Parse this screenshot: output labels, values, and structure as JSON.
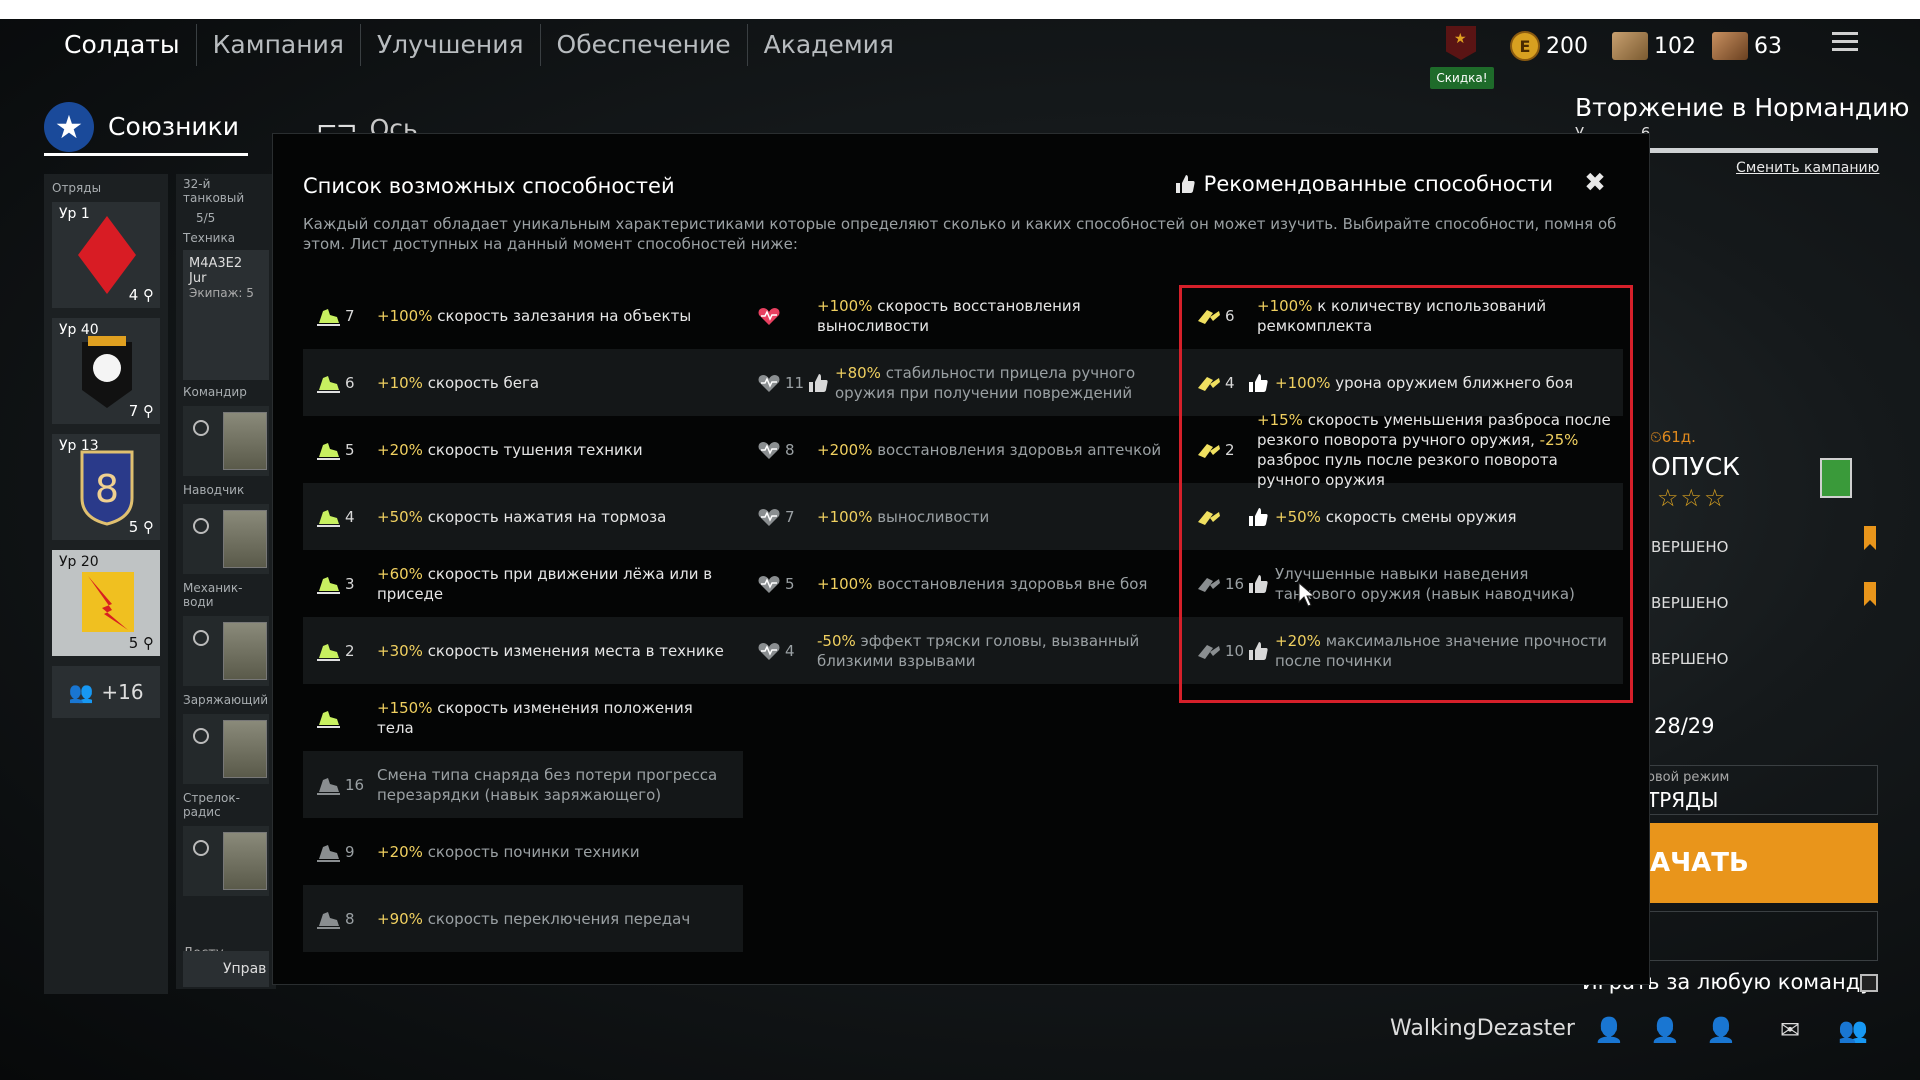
{
  "nav": {
    "tabs": [
      {
        "label": "Солдаты",
        "active": true
      },
      {
        "label": "Кампания",
        "active": false
      },
      {
        "label": "Улучшения",
        "active": false
      },
      {
        "label": "Обеспечение",
        "active": false
      },
      {
        "label": "Академия",
        "active": false
      }
    ]
  },
  "currency": {
    "gold": "200",
    "cards_a": "102",
    "cards_b": "63",
    "discount": "Скидка!"
  },
  "factions": {
    "allies": "Союзники",
    "axis": "Ось"
  },
  "squads": {
    "header": "Отряды",
    "items": [
      {
        "level": "Ур 1",
        "count": "4"
      },
      {
        "level": "Ур 40",
        "count": "7"
      },
      {
        "level": "Ур 13",
        "count": "5"
      },
      {
        "level": "Ур 20",
        "count": "5"
      }
    ],
    "reserve": "+16"
  },
  "crew": {
    "unit": "32-й танковый",
    "slots": "5/5",
    "vehicle_label": "Техника",
    "vehicle": "M4A3E2 Jur",
    "crew_count": "Экипаж: 5",
    "roles": [
      "Командир",
      "Наводчик",
      "Механик-води",
      "Заряжающий",
      "Стрелок-радис"
    ],
    "available": "Досту",
    "manage": "Управ"
  },
  "campaign": {
    "title": "Вторжение в Нормандию",
    "level_partial": "У",
    "level_num": "6",
    "change": "Сменить кампанию",
    "timer": "61д.",
    "mission": "ОПУСК",
    "done_1": "ВЕРШЕНО",
    "done_2": "ВЕРШЕНО",
    "done_3": "ВЕРШЕНО",
    "progress": "28/29",
    "mode_label": "овой режим",
    "mode_value": "ТРЯДЫ",
    "start": "АЧАТЬ",
    "any_team": "Играть за любую команду"
  },
  "user": {
    "name": "WalkingDezaster"
  },
  "modal": {
    "title": "Список возможных способностей",
    "recommended": "Рекомендованные способности",
    "close": "✖",
    "description": "Каждый солдат обладает уникальным характеристиками которые определяют сколько и каких способностей он может изучить. Выбирайте способности, помня об этом. Лист доступных на данный момент способностей ниже:",
    "col1": [
      {
        "num": "7",
        "hl": "+100%",
        "text": " скорость залезания на объекты",
        "locked": false
      },
      {
        "num": "6",
        "hl": "+10%",
        "text": " скорость бега",
        "locked": false
      },
      {
        "num": "5",
        "hl": "+20%",
        "text": " скорость тушения техники",
        "locked": false
      },
      {
        "num": "4",
        "hl": "+50%",
        "text": " скорость нажатия на тормоза",
        "locked": false
      },
      {
        "num": "3",
        "hl": "+60%",
        "text": " скорость при движении лёжа или в приседе",
        "locked": false
      },
      {
        "num": "2",
        "hl": "+30%",
        "text": " скорость изменения места в технике",
        "locked": false
      },
      {
        "num": "",
        "hl": "+150%",
        "text": " скорость изменения положения тела",
        "locked": false
      },
      {
        "num": "16",
        "hl": "",
        "text": "Смена типа снаряда без потери прогресса перезарядки (навык заряжающего)",
        "locked": true
      },
      {
        "num": "9",
        "hl": "+20%",
        "text": " скорость починки техники",
        "locked": true
      },
      {
        "num": "8",
        "hl": "+90%",
        "text": " скорость переключения передач",
        "locked": true
      }
    ],
    "col2": [
      {
        "num": "",
        "hl": "+100%",
        "text": " скорость восстановления выносливости",
        "locked": false,
        "thumb": false
      },
      {
        "num": "11",
        "hl": "+80%",
        "text": " стабильности прицела ручного оружия при получении повреждений",
        "locked": true,
        "thumb": true
      },
      {
        "num": "8",
        "hl": "+200%",
        "text": " восстановления здоровья аптечкой",
        "locked": true,
        "thumb": false
      },
      {
        "num": "7",
        "hl": "+100%",
        "text": " выносливости",
        "locked": true,
        "thumb": false
      },
      {
        "num": "5",
        "hl": "+100%",
        "text": " восстановления здоровья вне боя",
        "locked": true,
        "thumb": false
      },
      {
        "num": "4",
        "hl": "-50%",
        "text": " эффект тряски головы, вызванный близкими взрывами",
        "locked": true,
        "thumb": false
      }
    ],
    "col3": [
      {
        "num": "6",
        "parts": [
          [
            "+100%",
            true
          ],
          [
            " к количеству использований ремкомплекта",
            false
          ]
        ],
        "locked": false,
        "thumb": false
      },
      {
        "num": "4",
        "parts": [
          [
            "+100%",
            true
          ],
          [
            " урона оружием ближнего боя",
            false
          ]
        ],
        "locked": false,
        "thumb": true
      },
      {
        "num": "2",
        "parts": [
          [
            "+15%",
            true
          ],
          [
            " скорость уменьшения разброса после резкого поворота ручного оружия, ",
            false
          ],
          [
            "-25%",
            true
          ],
          [
            " разброс пуль после резкого поворота ручного оружия",
            false
          ]
        ],
        "locked": false,
        "thumb": false
      },
      {
        "num": "",
        "parts": [
          [
            "+50%",
            true
          ],
          [
            " скорость смены оружия",
            false
          ]
        ],
        "locked": false,
        "thumb": true
      },
      {
        "num": "16",
        "parts": [
          [
            "Улучшенные навыки наведения танкового оружия (навык наводчика)",
            false
          ]
        ],
        "locked": true,
        "thumb": true
      },
      {
        "num": "10",
        "parts": [
          [
            "+20%",
            true
          ],
          [
            " максимальное значение прочности после починки",
            false
          ]
        ],
        "locked": true,
        "thumb": true
      }
    ]
  },
  "colors": {
    "accent": "#e9951b",
    "highlight": "#f0d060",
    "redbox": "#d6202a"
  }
}
